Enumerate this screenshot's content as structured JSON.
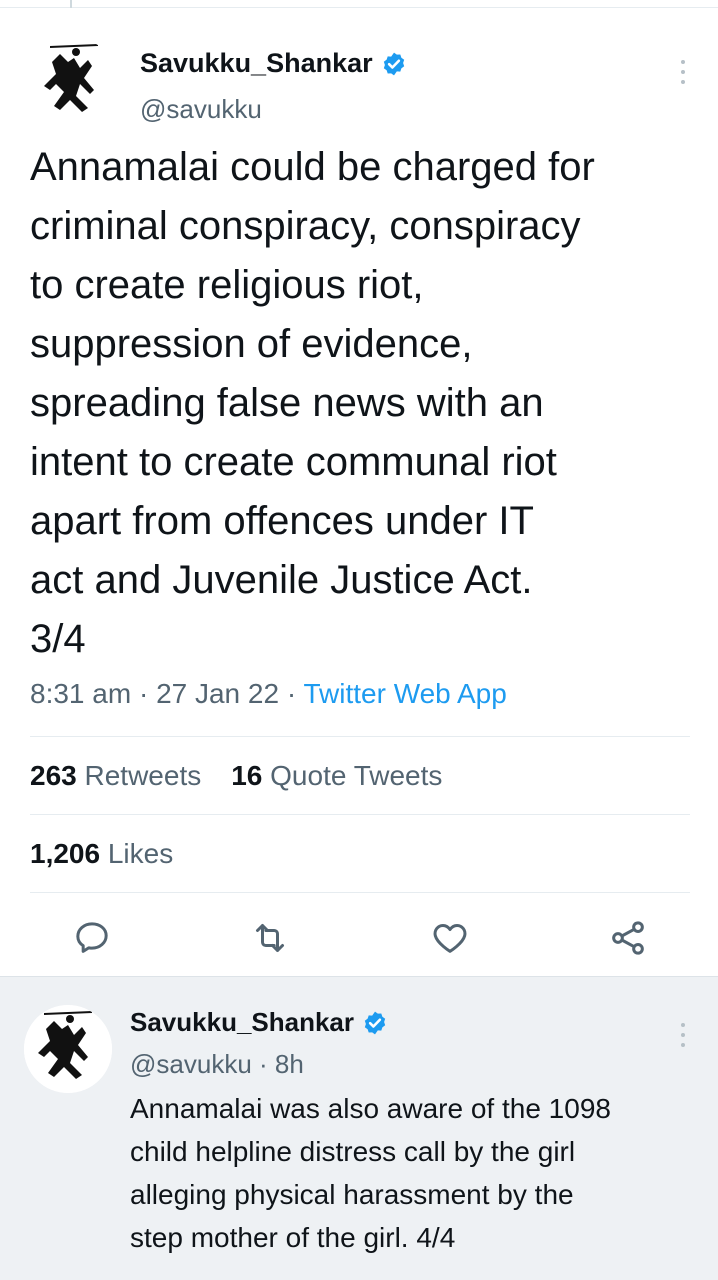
{
  "main_tweet": {
    "display_name": "Savukku_Shankar",
    "handle": "@savukku",
    "text": "Annamalai could be charged for\ncriminal conspiracy, conspiracy\nto create religious riot,\nsuppression of evidence,\nspreading false news with an\nintent to create communal riot\napart from offences under IT\nact and Juvenile Justice Act.\n3/4",
    "time": "8:31 am",
    "date": "27 Jan 22",
    "source": "Twitter Web App",
    "retweets_count": "263",
    "retweets_label": "Retweets",
    "quotes_count": "16",
    "quotes_label": "Quote Tweets",
    "likes_count": "1,206",
    "likes_label": "Likes",
    "actions": [
      "reply-icon",
      "retweet-icon",
      "like-icon",
      "share-icon"
    ]
  },
  "reply_tweet": {
    "display_name": "Savukku_Shankar",
    "handle": "@savukku",
    "relative_time": "8h",
    "text": "Annamalai was also aware of the 1098\nchild helpline distress call by the girl\nalleging physical harassment by the\nstep mother of the girl. 4/4"
  },
  "colors": {
    "accent": "#1d9bf0",
    "text": "#0f1419",
    "muted": "#536471",
    "reply_bg": "#eef1f4"
  }
}
